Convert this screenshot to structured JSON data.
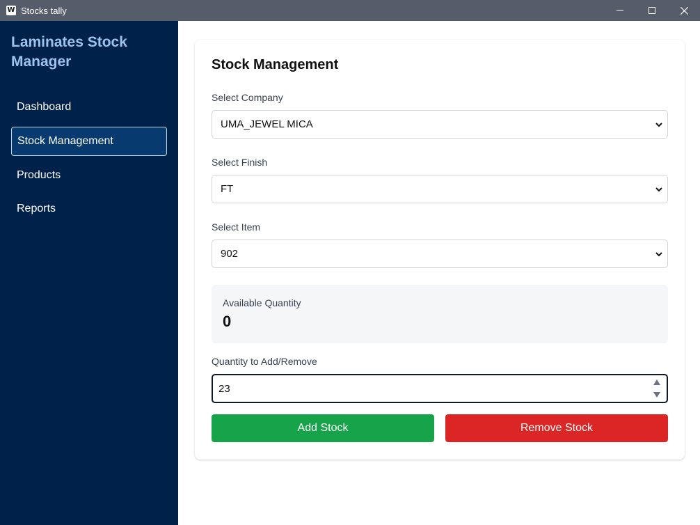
{
  "window": {
    "app_icon_letter": "W",
    "title": "Stocks tally"
  },
  "sidebar": {
    "brand": "Laminates Stock Manager",
    "items": [
      {
        "label": "Dashboard",
        "active": false
      },
      {
        "label": "Stock Management",
        "active": true
      },
      {
        "label": "Products",
        "active": false
      },
      {
        "label": "Reports",
        "active": false
      }
    ]
  },
  "main": {
    "title": "Stock Management",
    "company": {
      "label": "Select Company",
      "value": "UMA_JEWEL MICA"
    },
    "finish": {
      "label": "Select Finish",
      "value": "FT"
    },
    "item": {
      "label": "Select Item",
      "value": "902"
    },
    "available": {
      "label": "Available Quantity",
      "value": "0"
    },
    "quantity_input": {
      "label": "Quantity to Add/Remove",
      "value": "23"
    },
    "add_button": "Add Stock",
    "remove_button": "Remove Stock"
  },
  "colors": {
    "titlebar": "#565d6a",
    "sidebar": "#002149",
    "brand": "#9cc4ee",
    "active_item": "#073a6f",
    "add": "#16a34a",
    "remove": "#dc2626"
  },
  "icons": {
    "minimize": "minimize-icon",
    "maximize": "maximize-icon",
    "close": "close-icon",
    "dropdown": "chevron-down-icon",
    "spinner_up": "spinner-up-icon",
    "spinner_down": "spinner-down-icon"
  }
}
